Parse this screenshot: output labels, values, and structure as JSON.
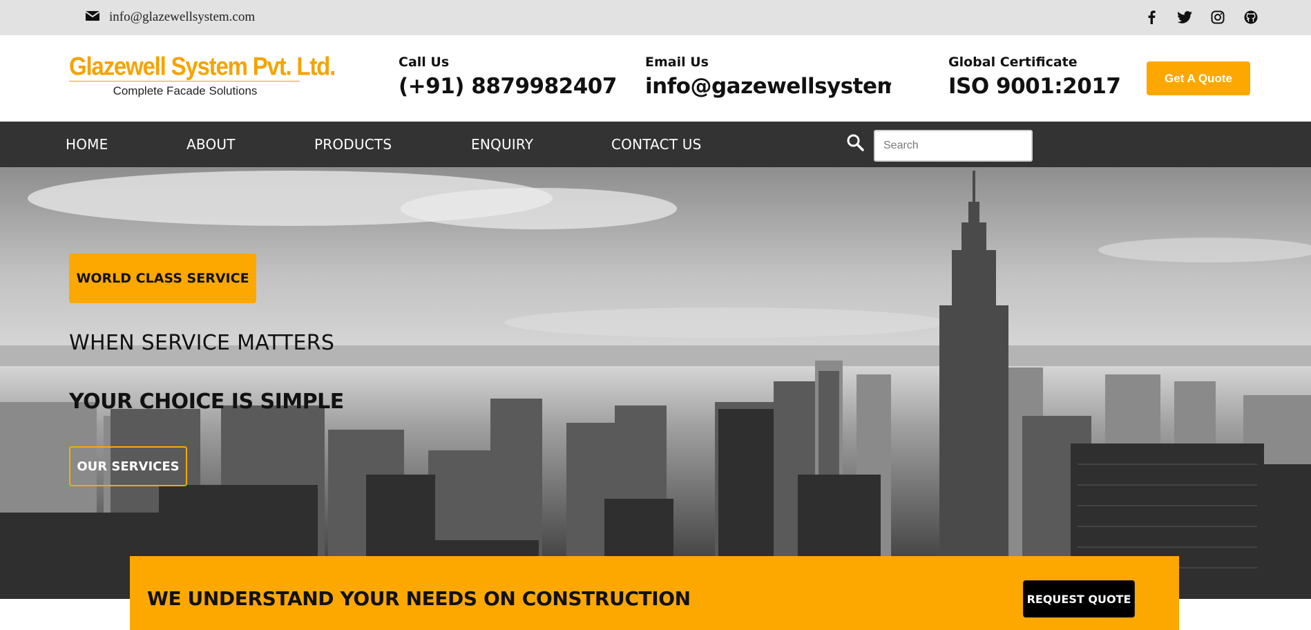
{
  "topbar": {
    "email": "info@glazewellsystem.com",
    "social_icons": [
      "facebook-icon",
      "twitter-icon",
      "instagram-icon",
      "github-icon"
    ]
  },
  "header": {
    "logo_title": "Glazewell System Pvt. Ltd.",
    "logo_subtitle": "Complete Facade Solutions",
    "call_label": "Call Us",
    "call_value": "(+91) 8879982407",
    "email_label": "Email Us",
    "email_value": "info@gazewellsystem.com",
    "cert_label": "Global Certificate",
    "cert_value": "ISO 9001:2017",
    "quote_button": "Get A Quote"
  },
  "nav": {
    "items": [
      {
        "label": "HOME"
      },
      {
        "label": "ABOUT"
      },
      {
        "label": "PRODUCTS"
      },
      {
        "label": "ENQUIRY"
      },
      {
        "label": "CONTACT US"
      }
    ],
    "search_placeholder": "Search"
  },
  "hero": {
    "badge": "WORLD CLASS SERVICE",
    "subheading": "WHEN SERVICE MATTERS",
    "heading": "YOUR CHOICE IS SIMPLE",
    "services_button": "OUR SERVICES"
  },
  "banner": {
    "text": "WE UNDERSTAND YOUR NEEDS ON CONSTRUCTION",
    "button": "REQUEST QUOTE"
  },
  "colors": {
    "accent": "#fca800",
    "nav_bg": "#333333",
    "topbar_bg": "#e2e2e2"
  }
}
